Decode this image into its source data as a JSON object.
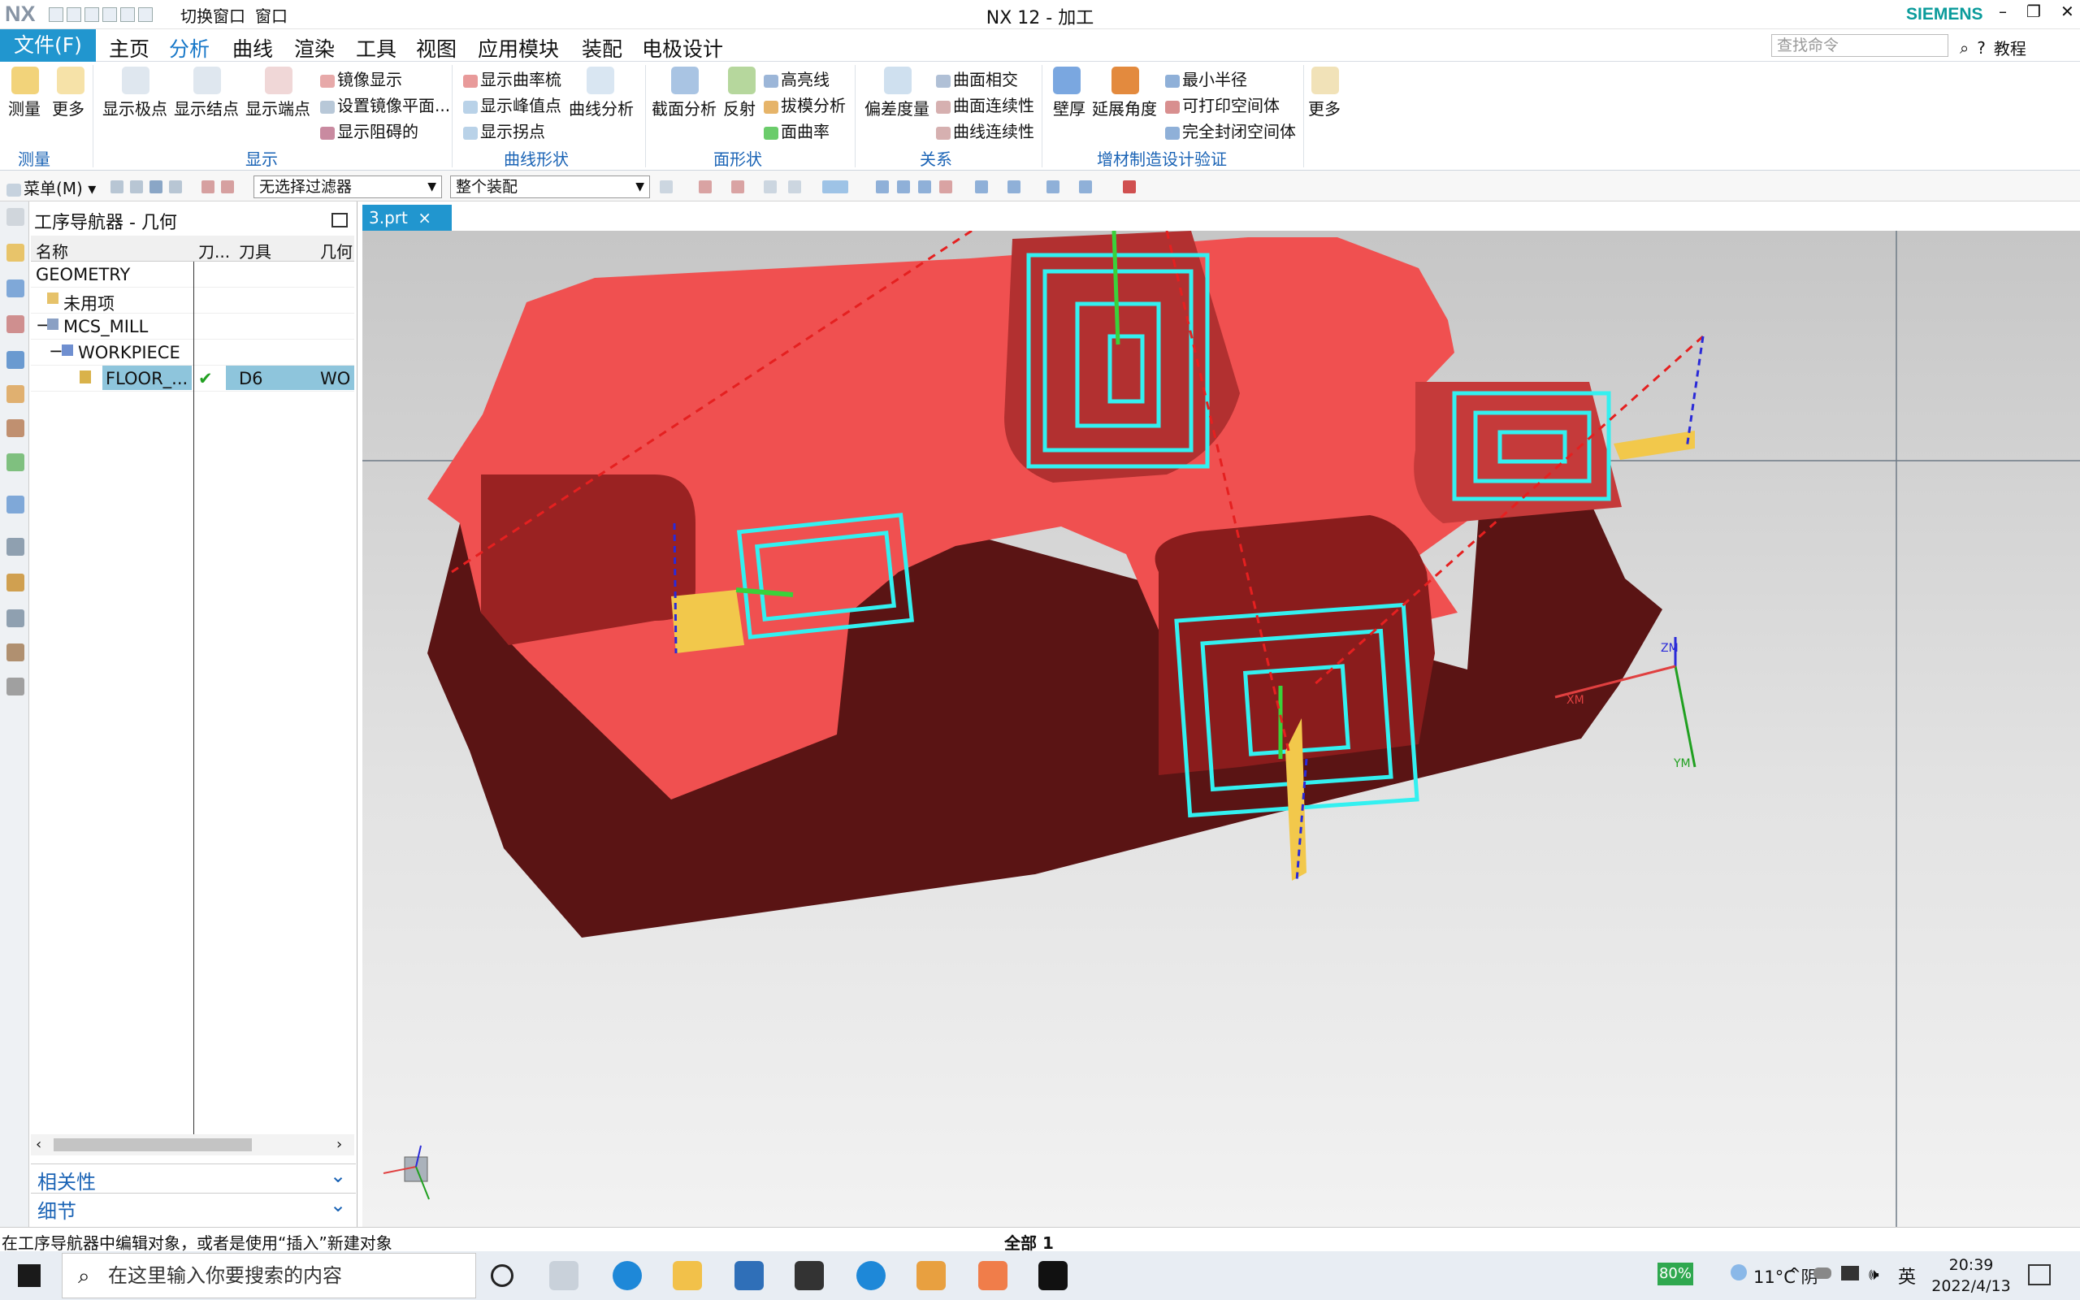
{
  "app": {
    "logo": "NX",
    "title": "NX 12 - 加工",
    "brand": "SIEMENS",
    "switch_window": "切换窗口",
    "window": "窗口"
  },
  "menubar": {
    "file": "文件(F)",
    "tabs": [
      "主页",
      "分析",
      "曲线",
      "渲染",
      "工具",
      "视图",
      "应用模块",
      "装配",
      "电极设计"
    ],
    "active_tab": "分析",
    "search_placeholder": "查找命令",
    "tutorial": "教程"
  },
  "ribbon": {
    "measure": {
      "measure": "测量",
      "more": "更多",
      "group": "测量"
    },
    "display": {
      "poles": "显示极点",
      "knots": "显示结点",
      "ends": "显示端点",
      "mirror": "镜像显示",
      "mirror_plane": "设置镜像平面...",
      "obstacles": "显示阻碍的",
      "group": "显示"
    },
    "curve_shape": {
      "comb": "显示曲率梳",
      "peak": "显示峰值点",
      "inflection": "显示拐点",
      "curve_analysis": "曲线分析",
      "group": "曲线形状"
    },
    "face_shape": {
      "section": "截面分析",
      "reflection": "反射",
      "highlight": "高亮线",
      "draft": "拔模分析",
      "face_curvature": "面曲率",
      "group": "面形状"
    },
    "relation": {
      "deviation": "偏差度量",
      "intersect": "曲面相交",
      "face_cont": "曲面连续性",
      "curve_cont": "曲线连续性",
      "group": "关系"
    },
    "additive": {
      "wall": "壁厚",
      "overhang": "延展角度",
      "min_radius": "最小半径",
      "printable": "可打印空间体",
      "closed": "完全封闭空间体",
      "group": "增材制造设计验证"
    },
    "more": "更多"
  },
  "selbar": {
    "menu": "菜单(M)",
    "filter": "无选择过滤器",
    "assembly": "整个装配"
  },
  "navigator": {
    "title": "工序导航器 - 几何",
    "columns": [
      "名称",
      "刀...",
      "刀具",
      "几何"
    ],
    "rows": [
      {
        "name": "GEOMETRY",
        "status": "",
        "tool": "",
        "geom": ""
      },
      {
        "name": "未用项",
        "status": "",
        "tool": "",
        "geom": ""
      },
      {
        "name": "MCS_MILL",
        "status": "",
        "tool": "",
        "geom": ""
      },
      {
        "name": "WORKPIECE",
        "status": "",
        "tool": "",
        "geom": ""
      },
      {
        "name": "FLOOR_...",
        "status": "✔",
        "tool": "D6",
        "geom": "WO"
      }
    ],
    "section1": "相关性",
    "section2": "细节"
  },
  "viewport": {
    "doc_tab": "3.prt",
    "triad": {
      "x": "XM",
      "y": "YM",
      "z": "ZM"
    }
  },
  "status": {
    "message": "在工序导航器中编辑对象，或者是使用“插入”新建对象",
    "center": "全部 1"
  },
  "taskbar": {
    "search": "在这里输入你要搜索的内容",
    "battery": "80%",
    "weather": "11°C 阴",
    "ime": "英",
    "time": "20:39",
    "date": "2022/4/13"
  },
  "colors": {
    "accent": "#2196cf",
    "part": "#f05050",
    "part_side": "#5c1515",
    "toolpath": "#33f0f0"
  }
}
